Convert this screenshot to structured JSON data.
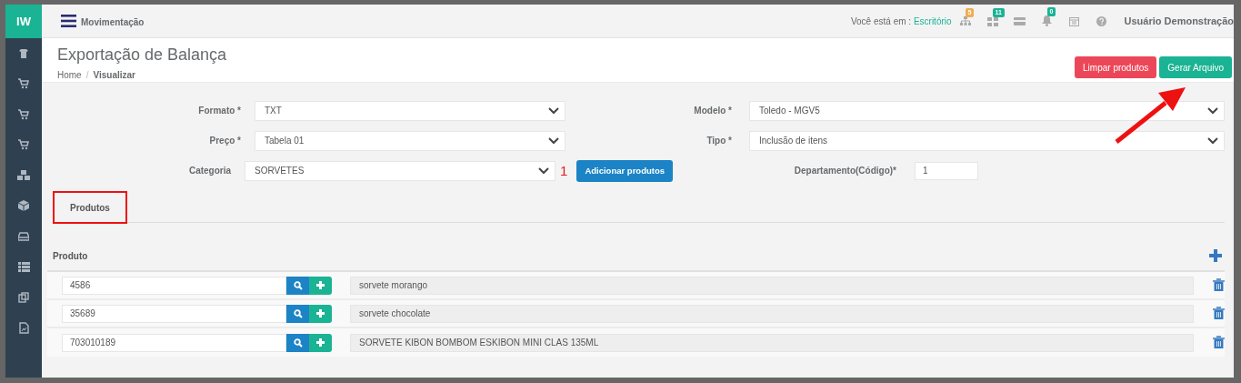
{
  "sidebar": {
    "logo": "IW",
    "icons": [
      {
        "kind": "shirt"
      },
      {
        "kind": "cart"
      },
      {
        "kind": "cart"
      },
      {
        "kind": "cart"
      },
      {
        "kind": "boxes"
      },
      {
        "kind": "cube"
      },
      {
        "kind": "tray"
      },
      {
        "kind": "list"
      },
      {
        "kind": "copy"
      },
      {
        "kind": "file"
      }
    ]
  },
  "topbar": {
    "menu_title": "Movimentação",
    "location_label": "Você está em :",
    "location": "Escritório",
    "icons": [
      {
        "kind": "sitemap",
        "badge": "5",
        "color": "#f0ad4e"
      },
      {
        "kind": "grid",
        "badge": "11",
        "color": "#1ab394"
      },
      {
        "kind": "card"
      },
      {
        "kind": "bell",
        "badge": "0",
        "color": "#1ab394"
      },
      {
        "kind": "calendar"
      },
      {
        "kind": "help"
      }
    ],
    "user": "Usuário Demonstração"
  },
  "header": {
    "title": "Exportação de Balança",
    "breadcrumb": [
      "Home",
      "Visualizar"
    ],
    "breadcrumb_separator": "/",
    "buttons": [
      {
        "label": "Limpar produtos",
        "kind": "danger"
      },
      {
        "label": "Gerar Arquivo",
        "kind": "primary"
      }
    ]
  },
  "form": {
    "formato": {
      "label": "Formato *",
      "value": "TXT"
    },
    "modelo": {
      "label": "Modelo *",
      "value": "Toledo - MGV5"
    },
    "preco": {
      "label": "Preço *",
      "value": "Tabela 01"
    },
    "tipo": {
      "label": "Tipo *",
      "value": "Inclusão de itens"
    },
    "categoria": {
      "label": "Categoria",
      "value": "SORVETES"
    },
    "add_button": "Adicionar produtos",
    "departamento": {
      "label": "Departamento(Código)*",
      "value": "1"
    }
  },
  "tabs": [
    {
      "label": "Produtos",
      "selected": true,
      "highlighted": true
    }
  ],
  "products": {
    "column": "Produto",
    "rows": [
      {
        "code": "4586",
        "description": "sorvete morango"
      },
      {
        "code": "35689",
        "description": "sorvete chocolate"
      },
      {
        "code": "703010189",
        "description": "SORVETE KIBON BOMBOM ESKIBON MINI CLAS 135ML"
      }
    ]
  },
  "annotations": {
    "number": "1",
    "arrow": true
  }
}
